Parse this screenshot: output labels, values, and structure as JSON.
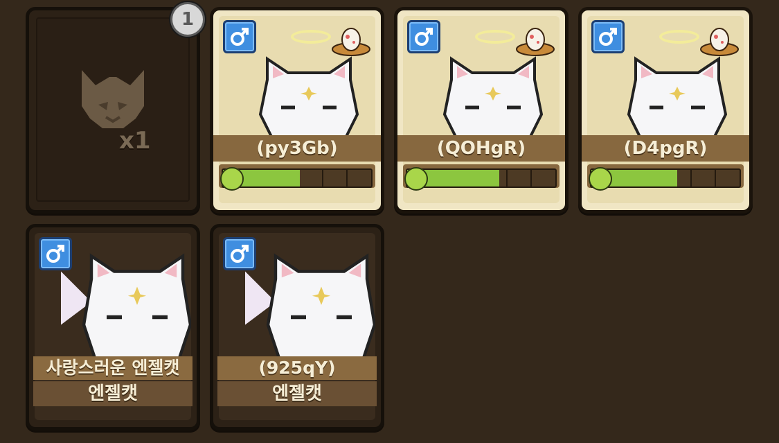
{
  "material_slot": {
    "badge": "1",
    "quantity": "x1",
    "icon": "cat-mask-silhouette-icon"
  },
  "pets_top": [
    {
      "name": "(py3Gb)",
      "gender": "male",
      "has_egg": true,
      "happiness": 0.52
    },
    {
      "name": "(QOHgR)",
      "gender": "male",
      "has_egg": true,
      "happiness": 0.62
    },
    {
      "name": "(D4pgR)",
      "gender": "male",
      "has_egg": true,
      "happiness": 0.58
    }
  ],
  "pets_bottom": [
    {
      "name": "사랑스러운 엔젤캣",
      "species": "엔젤캣",
      "gender": "male"
    },
    {
      "name": "(925qY)",
      "species": "엔젤캣",
      "gender": "male"
    }
  ],
  "colors": {
    "male": "#3f8ee0",
    "happiness_fill": "#8cc63f",
    "background": "#34281b"
  }
}
